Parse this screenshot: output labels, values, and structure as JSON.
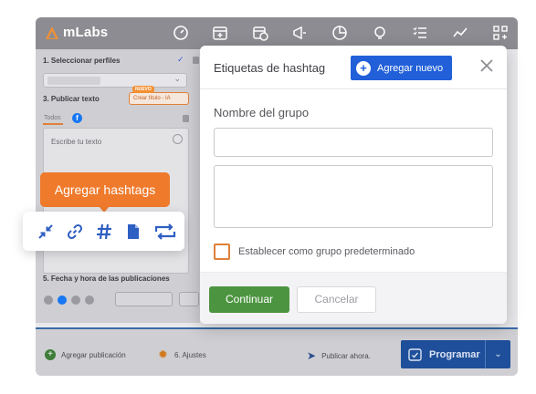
{
  "app": {
    "brand_name": "mLabs",
    "brand_color": "#f39032",
    "topbar_icons": [
      "dashboard-icon",
      "calendar-add-icon",
      "calendar-clock-icon",
      "megaphone-icon",
      "pie-chart-icon",
      "lightbulb-icon",
      "checklist-icon",
      "trend-line-icon",
      "apps-grid-icon"
    ]
  },
  "left_panel": {
    "step1_label": "1. Seleccionar perfiles",
    "step3_label": "3. Publicar texto",
    "ia_new_badge": "NUEVO",
    "ia_button": "Crear título - IA",
    "tab_all": "Todos",
    "text_placeholder": "Escribe tu texto",
    "step5_label": "5. Fecha y hora de las publicaciones"
  },
  "bottom_bar": {
    "add_publication": "Agregar publicación",
    "settings": "6. Ajustes",
    "publish_now": "Publicar ahora.",
    "schedule_button": "Programar"
  },
  "tooltip": {
    "text": "Agregar hashtags",
    "color": "#ef7a2c"
  },
  "floating_toolbar": {
    "icons": [
      "shrink-arrows-icon",
      "link-icon",
      "hashtag-icon",
      "document-icon",
      "repeat-icon"
    ],
    "accent": "#2e5fc2"
  },
  "modal": {
    "title": "Etiquetas de hashtag",
    "add_new_button": "Agregar nuevo",
    "group_name_label": "Nombre del grupo",
    "group_name_value": "",
    "hashtags_value": "",
    "default_group_checkbox_label": "Establecer como grupo predeterminado",
    "default_group_checked": false,
    "continue_button": "Continuar",
    "cancel_button": "Cancelar",
    "primary_color": "#2160d8",
    "continue_color": "#4d9441"
  }
}
